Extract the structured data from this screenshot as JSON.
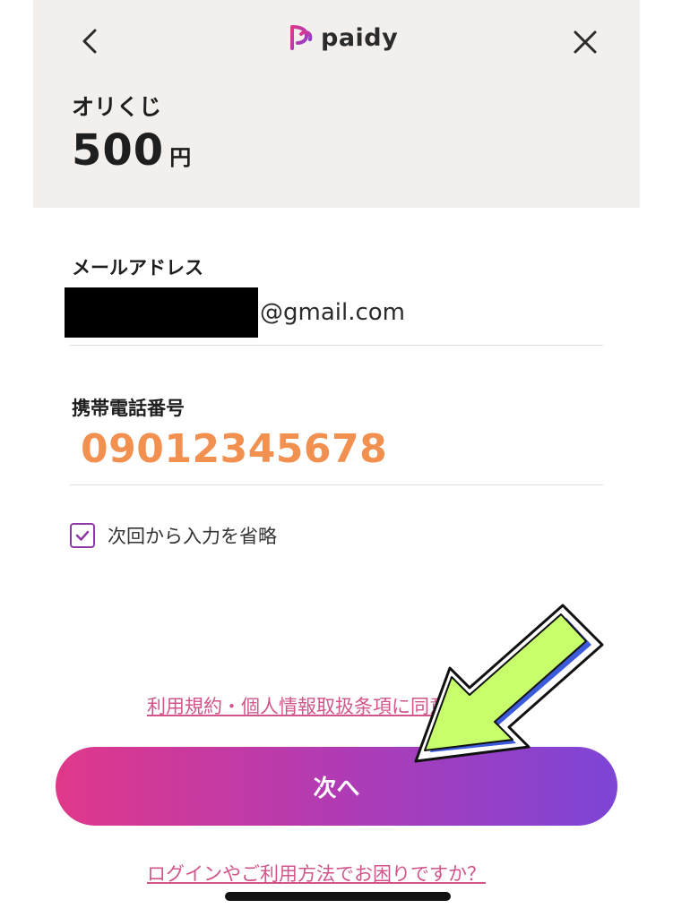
{
  "header": {
    "logo_text": "paidy",
    "merchant_name": "オリくじ",
    "amount": "500",
    "currency": "円"
  },
  "form": {
    "email": {
      "label": "メールアドレス",
      "value_suffix": "@gmail.com"
    },
    "phone": {
      "label": "携帯電話番号",
      "value": "09012345678"
    },
    "remember": {
      "label": "次回から入力を省略",
      "checked": true
    }
  },
  "footer": {
    "terms_link": "利用規約・個人情報取扱条項に同意して",
    "next_button": "次へ",
    "help_link": "ログインやご利用方法でお困りですか？"
  },
  "colors": {
    "header_bg": "#f3efed",
    "phone_text": "#f2904f",
    "link": "#d1558b",
    "button_gradient_start": "#e0388a",
    "button_gradient_end": "#7d45d6",
    "checkbox": "#8e3aa6",
    "arrow_fill": "#c6ff6b",
    "arrow_shadow": "#3b5bdb"
  },
  "icons": {
    "back": "chevron-left-icon",
    "close": "close-icon",
    "logo": "paidy-logo-icon",
    "check": "checkmark-icon",
    "arrow": "pointer-arrow-icon"
  }
}
